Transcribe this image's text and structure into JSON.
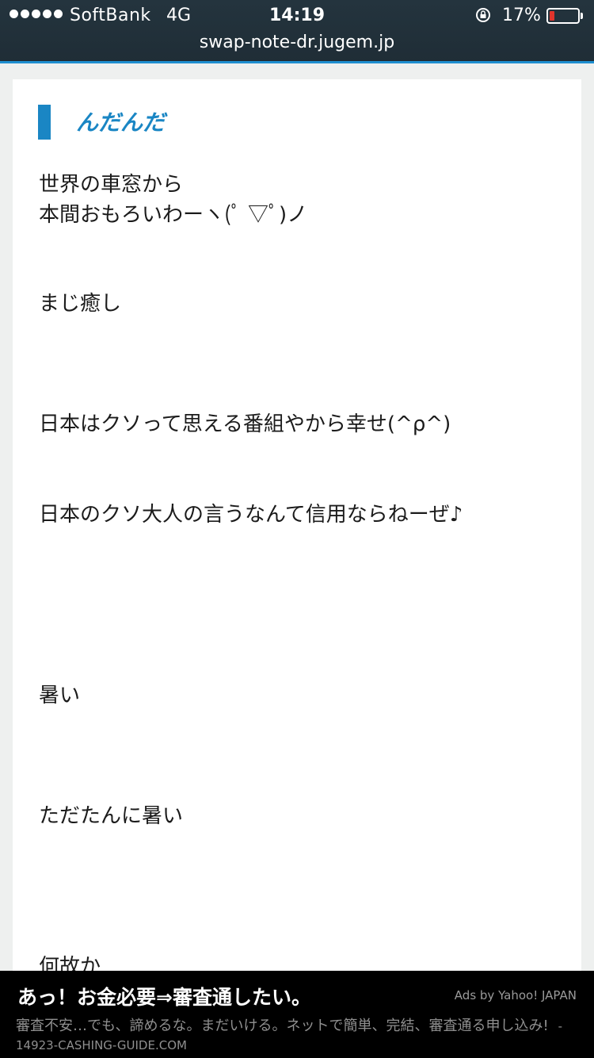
{
  "status_bar": {
    "carrier": "SoftBank",
    "network": "4G",
    "time": "14:19",
    "battery_percent": "17%",
    "battery_level": 0.17,
    "battery_color": "#e0342c",
    "url": "swap-note-dr.jugem.jp",
    "lock_icon": "rotation-lock-icon"
  },
  "post": {
    "title": "んだんだ",
    "accent_color": "#1a86c4",
    "lines": [
      "世界の車窓から",
      "本間おもろいわーヽ(ﾟ ▽ﾟ)ノ",
      "まじ癒し",
      "日本はクソって思える番組やから幸せ(^ρ^)",
      "日本のクソ大人の言うなんて信用ならねーぜ♪",
      "暑い",
      "ただたんに暑い",
      "何故か"
    ]
  },
  "ad": {
    "headline": "あっ！お金必要⇒審査通したい。",
    "source": "Ads by Yahoo! JAPAN",
    "body": "審査不安…でも、諦めるな。まだいける。ネットで簡単、完結、審査通る申し込み!",
    "domain": "- 14923-CASHING-GUIDE.COM"
  }
}
